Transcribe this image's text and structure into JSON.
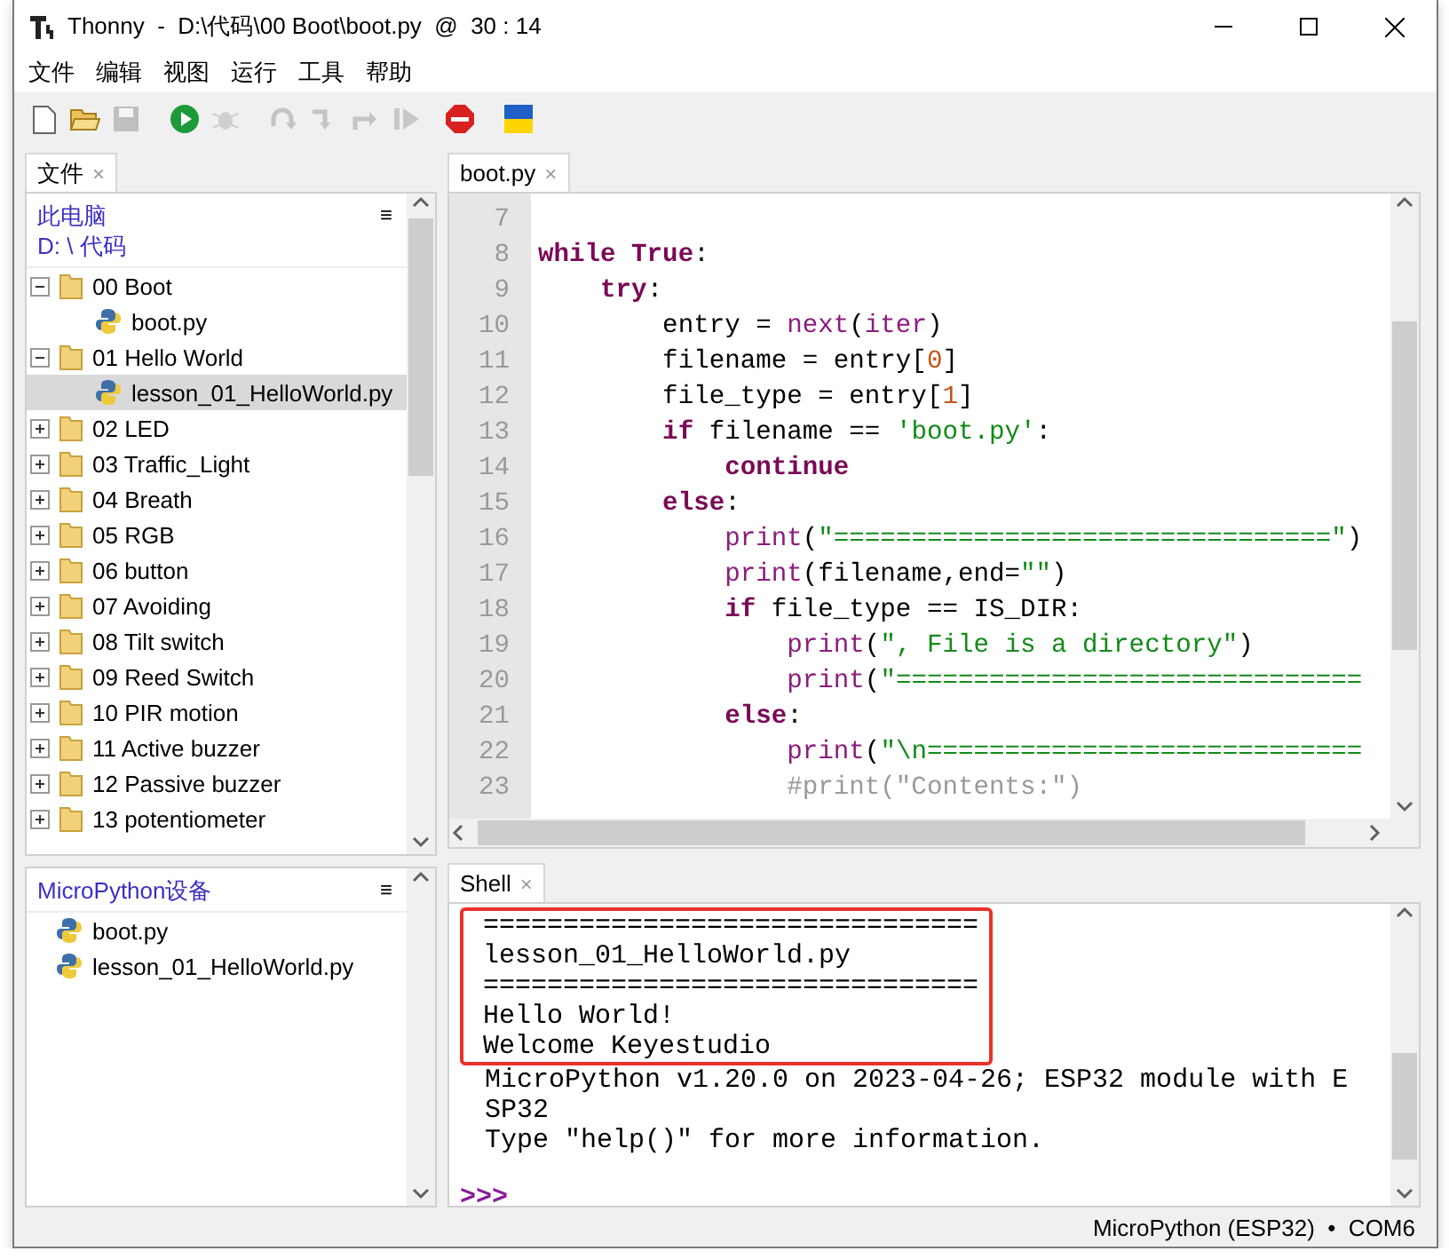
{
  "window": {
    "title": "Thonny  -  D:\\代码\\00 Boot\\boot.py  @  30 : 14"
  },
  "menu": [
    "文件",
    "编辑",
    "视图",
    "运行",
    "工具",
    "帮助"
  ],
  "toolbar": [
    {
      "kind": "new",
      "disabled": false
    },
    {
      "kind": "open",
      "disabled": false
    },
    {
      "kind": "save",
      "disabled": true
    },
    {
      "kind": "run",
      "disabled": false
    },
    {
      "kind": "debug",
      "disabled": true
    },
    {
      "kind": "step_over",
      "disabled": true
    },
    {
      "kind": "step_into",
      "disabled": true
    },
    {
      "kind": "step_out",
      "disabled": true
    },
    {
      "kind": "resume",
      "disabled": true
    },
    {
      "kind": "stop",
      "disabled": false
    },
    {
      "kind": "flag",
      "disabled": false
    }
  ],
  "files_panel": {
    "tab": {
      "label": "文件",
      "close": "×",
      "selected": true
    },
    "location": "此电脑",
    "path": "D: \\ 代码",
    "menu_glyph": "≡",
    "tree": [
      {
        "kind": "folder",
        "name": "00 Boot",
        "expanded": true,
        "selected": false,
        "children": [
          {
            "kind": "file",
            "name": "boot.py",
            "selected": false
          }
        ]
      },
      {
        "kind": "folder",
        "name": "01 Hello World",
        "expanded": true,
        "selected": false,
        "children": [
          {
            "kind": "file",
            "name": "lesson_01_HelloWorld.py",
            "selected": true
          }
        ]
      },
      {
        "kind": "folder",
        "name": "02 LED",
        "expanded": false,
        "selected": false
      },
      {
        "kind": "folder",
        "name": "03 Traffic_Light",
        "expanded": false,
        "selected": false
      },
      {
        "kind": "folder",
        "name": "04 Breath",
        "expanded": false,
        "selected": false
      },
      {
        "kind": "folder",
        "name": "05 RGB",
        "expanded": false,
        "selected": false
      },
      {
        "kind": "folder",
        "name": "06 button",
        "expanded": false,
        "selected": false
      },
      {
        "kind": "folder",
        "name": "07 Avoiding",
        "expanded": false,
        "selected": false
      },
      {
        "kind": "folder",
        "name": "08 Tilt switch",
        "expanded": false,
        "selected": false
      },
      {
        "kind": "folder",
        "name": "09 Reed Switch",
        "expanded": false,
        "selected": false
      },
      {
        "kind": "folder",
        "name": "10 PIR motion",
        "expanded": false,
        "selected": false
      },
      {
        "kind": "folder",
        "name": "11 Active buzzer",
        "expanded": false,
        "selected": false
      },
      {
        "kind": "folder",
        "name": "12 Passive buzzer",
        "expanded": false,
        "selected": false
      },
      {
        "kind": "folder",
        "name": "13 potentiometer",
        "expanded": false,
        "selected": false
      }
    ]
  },
  "device_panel": {
    "title": "MicroPython设备",
    "menu_glyph": "≡",
    "files": [
      {
        "name": "boot.py",
        "selected": false
      },
      {
        "name": "lesson_01_HelloWorld.py",
        "selected": false
      }
    ]
  },
  "editor": {
    "tab": {
      "label": "boot.py",
      "close": "×",
      "selected": true
    },
    "lines": [
      {
        "number": "7"
      },
      {
        "number": "8",
        "tokens": [
          {
            "kind": "keyword",
            "text": "while True"
          },
          {
            "kind": "plain",
            "text": ":"
          }
        ]
      },
      {
        "number": "9",
        "tokens": [
          {
            "kind": "keyword",
            "text": "    try"
          },
          {
            "kind": "plain",
            "text": ":"
          }
        ]
      },
      {
        "number": "10",
        "tokens": [
          {
            "kind": "plain",
            "text": "        entry = "
          },
          {
            "kind": "builtin",
            "text": "next"
          },
          {
            "kind": "plain",
            "text": "("
          },
          {
            "kind": "builtin",
            "text": "iter"
          },
          {
            "kind": "plain",
            "text": ")"
          }
        ]
      },
      {
        "number": "11",
        "tokens": [
          {
            "kind": "plain",
            "text": "        filename = entry["
          },
          {
            "kind": "number",
            "text": "0"
          },
          {
            "kind": "plain",
            "text": "]"
          }
        ]
      },
      {
        "number": "12",
        "tokens": [
          {
            "kind": "plain",
            "text": "        file_type = entry["
          },
          {
            "kind": "number",
            "text": "1"
          },
          {
            "kind": "plain",
            "text": "]"
          }
        ]
      },
      {
        "number": "13",
        "tokens": [
          {
            "kind": "keyword",
            "text": "        if"
          },
          {
            "kind": "plain",
            "text": " filename == "
          },
          {
            "kind": "string",
            "text": "'boot.py'"
          },
          {
            "kind": "plain",
            "text": ":"
          }
        ]
      },
      {
        "number": "14",
        "tokens": [
          {
            "kind": "keyword",
            "text": "            continue"
          }
        ]
      },
      {
        "number": "15",
        "tokens": [
          {
            "kind": "keyword",
            "text": "        else"
          },
          {
            "kind": "plain",
            "text": ":"
          }
        ]
      },
      {
        "number": "16",
        "tokens": [
          {
            "kind": "builtin",
            "text": "            print"
          },
          {
            "kind": "plain",
            "text": "("
          },
          {
            "kind": "string",
            "text": "\"================================\""
          },
          {
            "kind": "plain",
            "text": ")"
          }
        ]
      },
      {
        "number": "17",
        "tokens": [
          {
            "kind": "builtin",
            "text": "            print"
          },
          {
            "kind": "plain",
            "text": "(filename,end="
          },
          {
            "kind": "string",
            "text": "\"\""
          },
          {
            "kind": "plain",
            "text": ")"
          }
        ]
      },
      {
        "number": "18",
        "tokens": [
          {
            "kind": "keyword",
            "text": "            if"
          },
          {
            "kind": "plain",
            "text": " file_type == IS_DIR:"
          }
        ]
      },
      {
        "number": "19",
        "tokens": [
          {
            "kind": "builtin",
            "text": "                print"
          },
          {
            "kind": "plain",
            "text": "("
          },
          {
            "kind": "string",
            "text": "\", File is a directory\""
          },
          {
            "kind": "plain",
            "text": ")"
          }
        ]
      },
      {
        "number": "20",
        "tokens": [
          {
            "kind": "builtin",
            "text": "                print"
          },
          {
            "kind": "plain",
            "text": "("
          },
          {
            "kind": "string",
            "text": "\"=============================="
          }
        ]
      },
      {
        "number": "21",
        "tokens": [
          {
            "kind": "keyword",
            "text": "            else"
          },
          {
            "kind": "plain",
            "text": ":"
          }
        ]
      },
      {
        "number": "22",
        "tokens": [
          {
            "kind": "builtin",
            "text": "                print"
          },
          {
            "kind": "plain",
            "text": "("
          },
          {
            "kind": "string",
            "text": "\"\\n============================"
          }
        ]
      },
      {
        "number": "23",
        "tokens": [
          {
            "kind": "comment",
            "text": "                #print(\"Contents:\")"
          }
        ]
      }
    ]
  },
  "shell": {
    "tab": {
      "label": "Shell",
      "close": "×",
      "selected": true
    },
    "highlighted_output": [
      "===============================",
      "lesson_01_HelloWorld.py",
      "===============================",
      "Hello World!",
      "Welcome Keyestudio"
    ],
    "output": [
      "MicroPython v1.20.0 on 2023-04-26; ESP32 module with E",
      "SP32",
      "Type \"help()\" for more information."
    ],
    "prompt": ">>>"
  },
  "status_bar": {
    "connection": "MicroPython (ESP32)  •  COM6"
  }
}
